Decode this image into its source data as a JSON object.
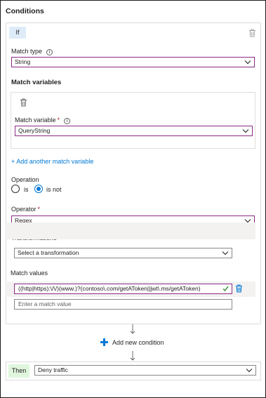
{
  "title": "Conditions",
  "if_block": {
    "badge": "If",
    "match_type": {
      "label": "Match type",
      "value": "String"
    },
    "match_variables_title": "Match variables",
    "match_variable": {
      "label": "Match variable",
      "required_mark": "*",
      "value": "QueryString"
    },
    "add_match_variable_label": "+ Add another match variable",
    "operation": {
      "label": "Operation",
      "options": [
        "is",
        "is not"
      ],
      "selected": "is not"
    },
    "operator": {
      "label": "Operator",
      "required_mark": "*",
      "value": "Regex"
    },
    "transformations": {
      "label": "Transformations",
      "placeholder": "Select a transformation"
    },
    "match_values": {
      "label": "Match values",
      "value": "((http|https):\\/\\/)(www.)?(contoso\\.com/getAToken||jwt\\.ms/getAToken)",
      "placeholder": "Enter a match value"
    }
  },
  "add_condition_label": "Add new condition",
  "then_block": {
    "badge": "Then",
    "action": "Deny traffic"
  },
  "icons": {
    "delete": "trash-icon",
    "info": "info-icon",
    "dropdown": "chevron-down-icon",
    "add": "plus-icon",
    "flow": "arrow-down-icon",
    "valid": "checkmark-icon"
  },
  "colors": {
    "accent": "#0078d4",
    "focus_border": "#8a2a86",
    "if_badge": "#deecf9",
    "then_badge": "#dff6dd",
    "required": "#a4262c",
    "valid": "#107c10"
  }
}
